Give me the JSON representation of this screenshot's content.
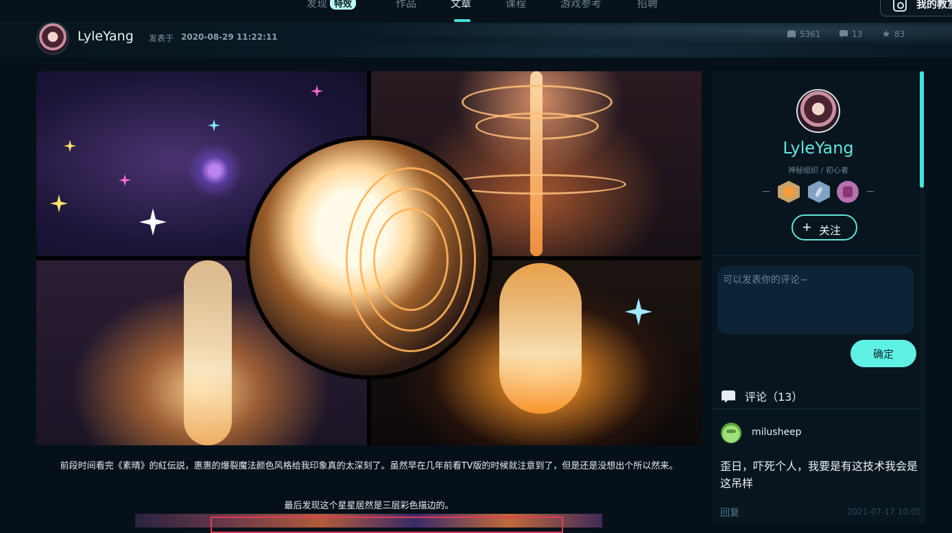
{
  "nav": {
    "items": [
      {
        "label": "发现",
        "badge": "特效"
      },
      {
        "label": "作品"
      },
      {
        "label": "文章",
        "active": true
      },
      {
        "label": "课程"
      },
      {
        "label": "游戏参考"
      },
      {
        "label": "招聘"
      }
    ],
    "my_button": "我的教室"
  },
  "author": {
    "name": "LyleYang",
    "posted_label": "发表于",
    "posted_date": "2020-08-29 11:22:11"
  },
  "stats": {
    "views": "5361",
    "comments": "13",
    "favorites": "83"
  },
  "article": {
    "paragraph1": "前段时间看完《素晴》的紅伝説，惠惠的爆裂魔法颜色风格给我印象真的太深刻了。虽然早在几年前看TV版的时候就注意到了，但是还是没想出个所以然来。",
    "paragraph2": "最后发现这个星星居然是三层彩色描边的。"
  },
  "profile": {
    "name": "LyleYang",
    "title": "神秘组织 / 初心者",
    "follow_label": "关注",
    "badges": [
      "flame-badge",
      "compass-badge",
      "crown-badge"
    ]
  },
  "comment_form": {
    "placeholder": "可以发表你的评论~",
    "value": "",
    "submit_label": "确定"
  },
  "comments": {
    "header": "评论（13）",
    "items": [
      {
        "user": "milusheep",
        "text": "歪日，吓死个人，我要是有这技术我会是这吊样",
        "reply_label": "回复",
        "date": "2021-07-17 10:05"
      }
    ]
  },
  "colors": {
    "accent": "#5fe6dc",
    "background": "#061019",
    "sidebar": "#08151f"
  }
}
